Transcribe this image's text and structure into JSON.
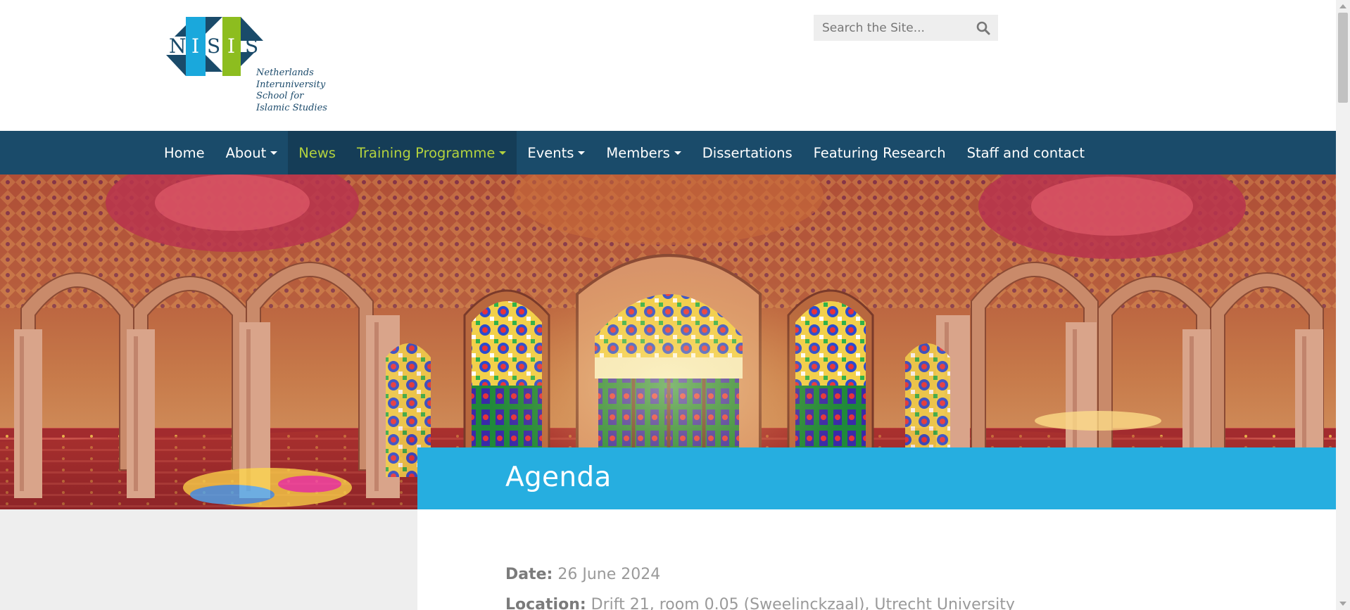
{
  "site": {
    "logo_letters": [
      "N",
      "I",
      "S",
      "I",
      "S"
    ],
    "logo_lines": [
      "Netherlands",
      "Interuniversity",
      "School for",
      "Islamic Studies"
    ]
  },
  "search": {
    "placeholder": "Search the Site..."
  },
  "nav": {
    "items": [
      {
        "label": "Home",
        "dropdown": false,
        "state": "normal"
      },
      {
        "label": "About",
        "dropdown": true,
        "state": "normal"
      },
      {
        "label": "News",
        "dropdown": false,
        "state": "current"
      },
      {
        "label": "Training Programme",
        "dropdown": true,
        "state": "current"
      },
      {
        "label": "Events",
        "dropdown": true,
        "state": "normal"
      },
      {
        "label": "Members",
        "dropdown": true,
        "state": "normal"
      },
      {
        "label": "Dissertations",
        "dropdown": false,
        "state": "normal"
      },
      {
        "label": "Featuring Research",
        "dropdown": false,
        "state": "normal"
      },
      {
        "label": "Staff and contact",
        "dropdown": false,
        "state": "normal"
      }
    ]
  },
  "page": {
    "title": "Agenda",
    "date_label": "Date:",
    "date_value": "26 June 2024",
    "location_label": "Location:",
    "location_value": "Drift 21, room 0.05 (Sweelinckzaal), Utrecht University"
  },
  "colors": {
    "nav_bg": "#1a4b6a",
    "nav_active_bg": "#153d57",
    "accent_green": "#b3d23e",
    "agenda_bar": "#26aee0",
    "logo_dark": "#1a4b6a",
    "logo_cyan": "#1aa8dc",
    "logo_green": "#8dbd1f"
  },
  "icons": {
    "search": "search-icon",
    "caret": "caret-down-icon"
  }
}
